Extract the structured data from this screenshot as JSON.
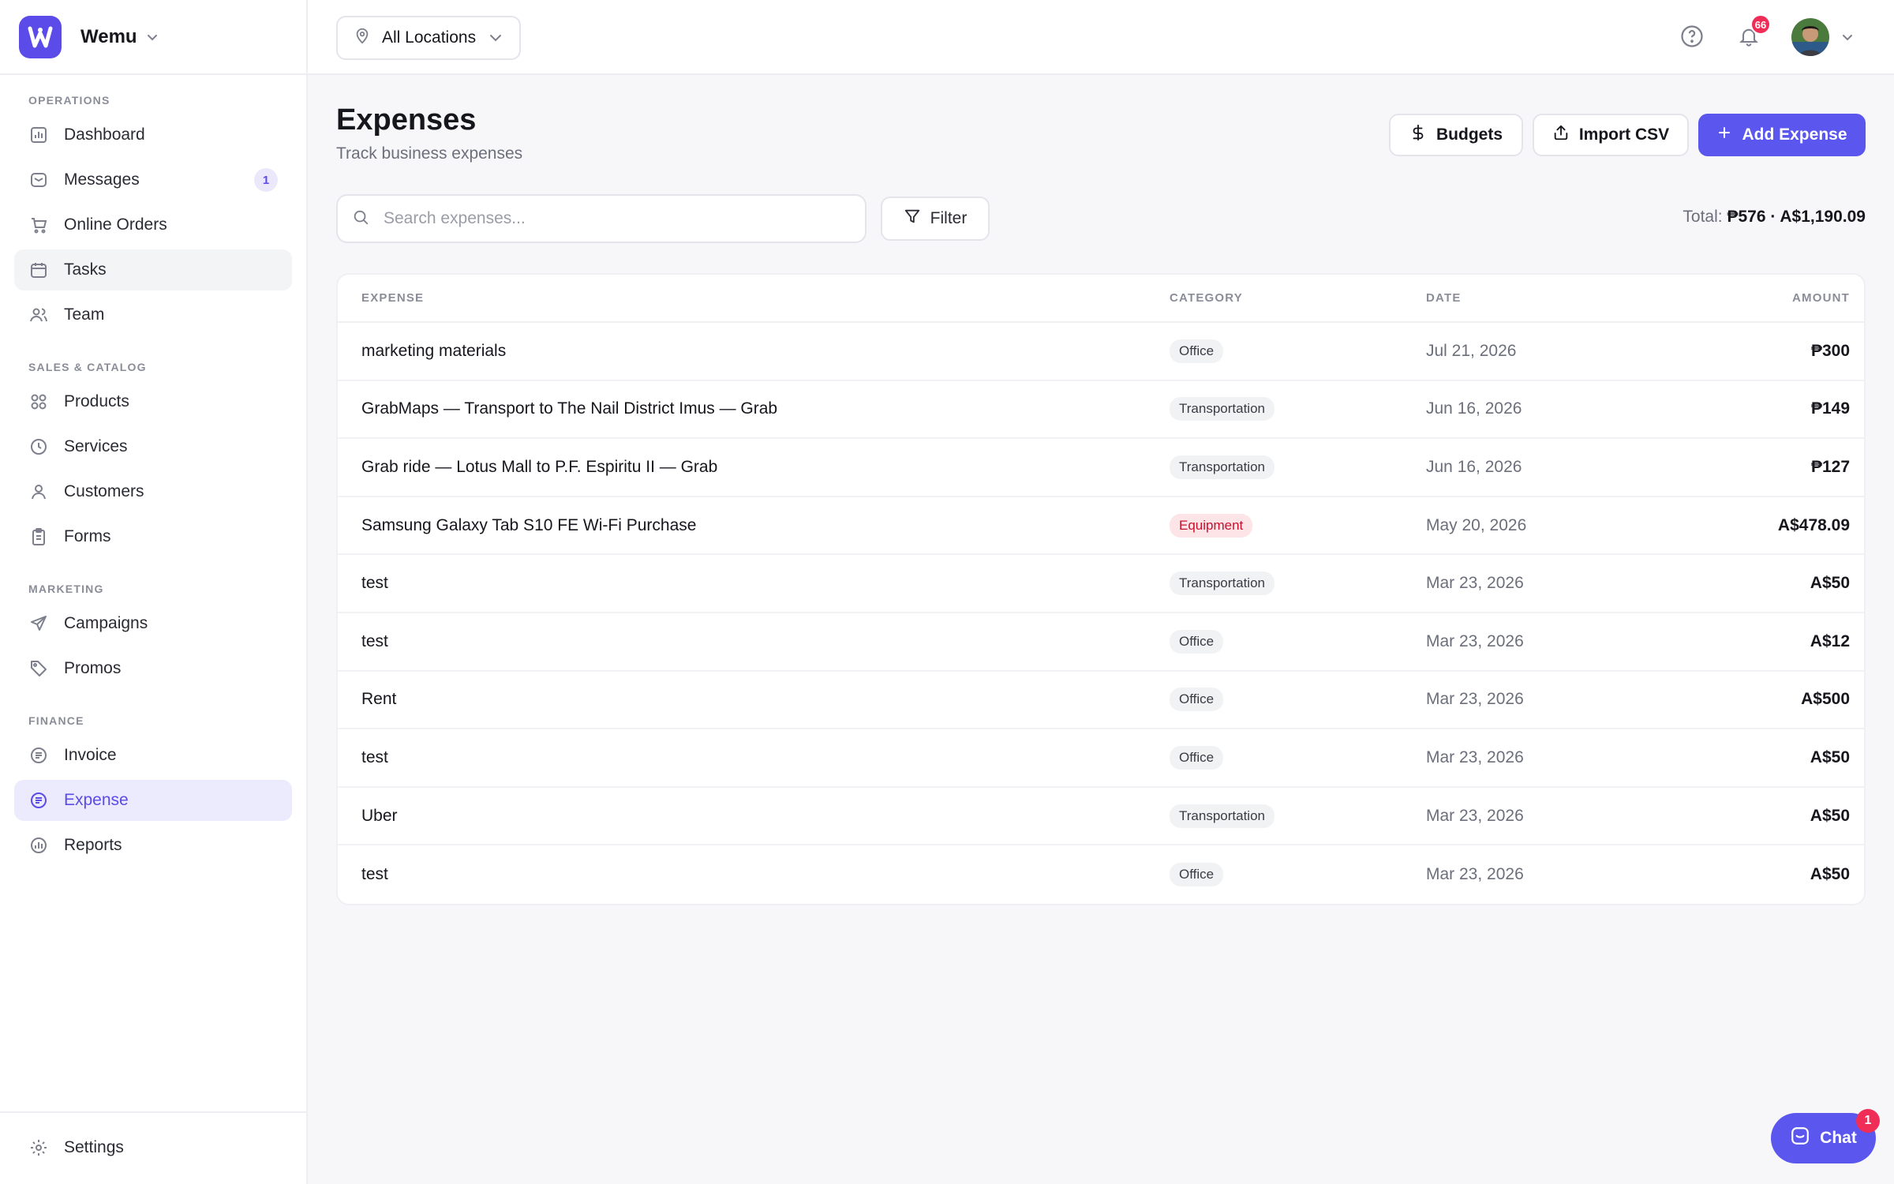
{
  "app": {
    "name": "Wemu",
    "accent": "#5b57ee"
  },
  "sidebar": {
    "sections": [
      {
        "title": "OPERATIONS",
        "items": [
          {
            "label": "Dashboard",
            "icon": "bar-chart-icon"
          },
          {
            "label": "Messages",
            "icon": "inbox-icon",
            "badge": "1"
          },
          {
            "label": "Online Orders",
            "icon": "cart-icon"
          },
          {
            "label": "Tasks",
            "icon": "calendar-icon"
          },
          {
            "label": "Team",
            "icon": "users-icon"
          }
        ]
      },
      {
        "title": "SALES & CATALOG",
        "items": [
          {
            "label": "Products",
            "icon": "grid-icon"
          },
          {
            "label": "Services",
            "icon": "clock-icon"
          },
          {
            "label": "Customers",
            "icon": "user-icon"
          },
          {
            "label": "Forms",
            "icon": "clipboard-icon"
          }
        ]
      },
      {
        "title": "MARKETING",
        "items": [
          {
            "label": "Campaigns",
            "icon": "send-icon"
          },
          {
            "label": "Promos",
            "icon": "tag-icon"
          }
        ]
      },
      {
        "title": "FINANCE",
        "items": [
          {
            "label": "Invoice",
            "icon": "invoice-icon"
          },
          {
            "label": "Expense",
            "icon": "expense-icon"
          },
          {
            "label": "Reports",
            "icon": "bar-chart-icon"
          }
        ]
      }
    ],
    "footer": {
      "label": "Settings",
      "icon": "gear-icon"
    }
  },
  "topbar": {
    "location": "All Locations",
    "notifications_count": "66"
  },
  "page": {
    "title": "Expenses",
    "subtitle": "Track business expenses",
    "buttons": {
      "budgets": "Budgets",
      "import_csv": "Import CSV",
      "add_expense": "Add Expense"
    },
    "search_placeholder": "Search expenses...",
    "filter_label": "Filter",
    "total_label": "Total:",
    "total_value": "₱576 · A$1,190.09"
  },
  "table": {
    "columns": {
      "expense": "EXPENSE",
      "category": "CATEGORY",
      "date": "DATE",
      "amount": "AMOUNT"
    },
    "rows": [
      {
        "expense": "marketing materials",
        "category": "Office",
        "date": "Jul 21, 2026",
        "amount": "₱300"
      },
      {
        "expense": "GrabMaps — Transport to The Nail District Imus — Grab",
        "category": "Transportation",
        "date": "Jun 16, 2026",
        "amount": "₱149"
      },
      {
        "expense": "Grab ride — Lotus Mall to P.F. Espiritu II — Grab",
        "category": "Transportation",
        "date": "Jun 16, 2026",
        "amount": "₱127"
      },
      {
        "expense": "Samsung Galaxy Tab S10 FE Wi-Fi Purchase",
        "category": "Equipment",
        "date": "May 20, 2026",
        "amount": "A$478.09"
      },
      {
        "expense": "test",
        "category": "Transportation",
        "date": "Mar 23, 2026",
        "amount": "A$50"
      },
      {
        "expense": "test",
        "category": "Office",
        "date": "Mar 23, 2026",
        "amount": "A$12"
      },
      {
        "expense": "Rent",
        "category": "Office",
        "date": "Mar 23, 2026",
        "amount": "A$500"
      },
      {
        "expense": "test",
        "category": "Office",
        "date": "Mar 23, 2026",
        "amount": "A$50"
      },
      {
        "expense": "Uber",
        "category": "Transportation",
        "date": "Mar 23, 2026",
        "amount": "A$50"
      },
      {
        "expense": "test",
        "category": "Office",
        "date": "Mar 23, 2026",
        "amount": "A$50"
      }
    ]
  },
  "chat": {
    "label": "Chat",
    "badge": "1"
  }
}
